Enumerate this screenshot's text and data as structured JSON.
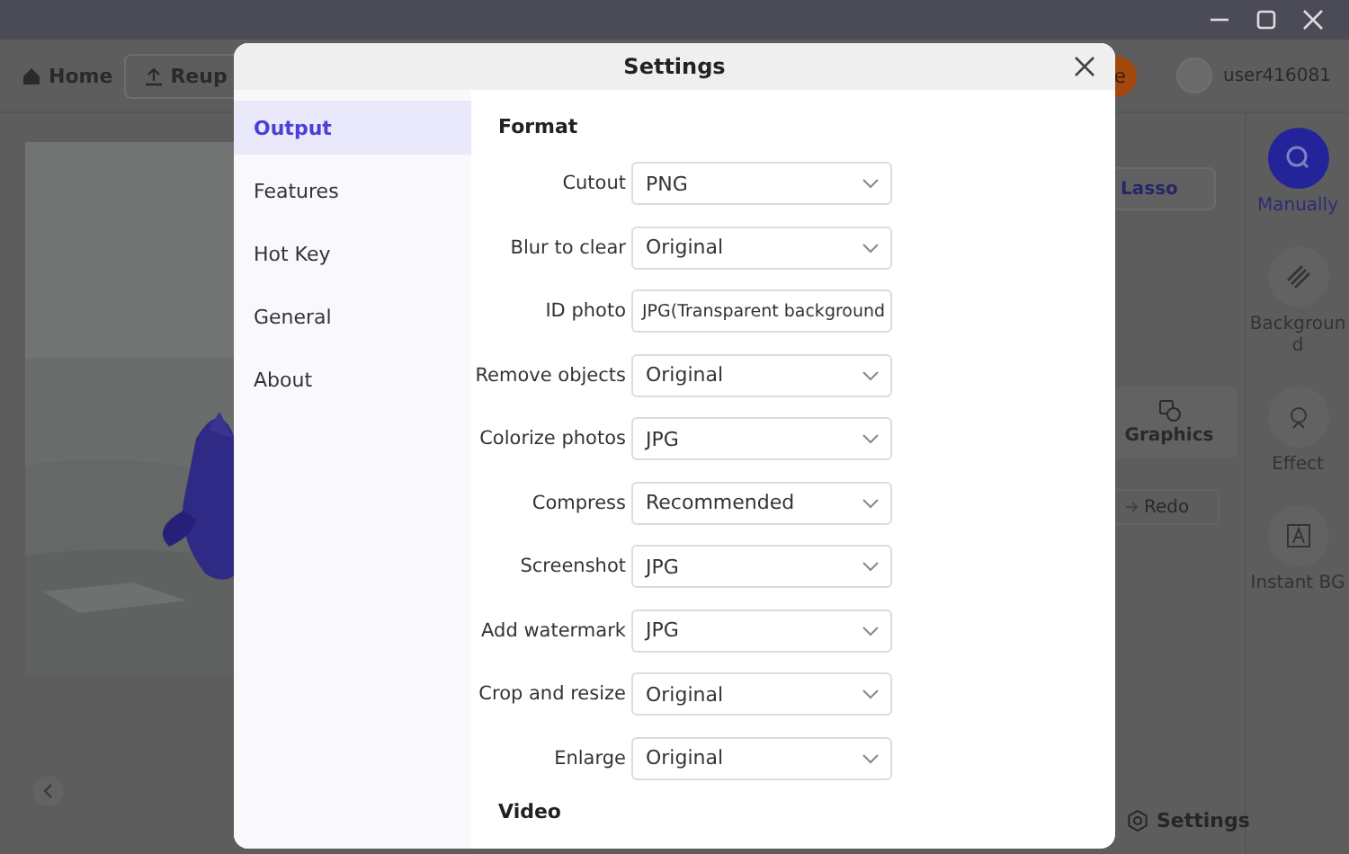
{
  "app": {
    "home": "Home",
    "reupload": "Reup",
    "action_button": "e",
    "user": "user416081",
    "tools": {
      "lasso": "Lasso",
      "graphics": "Graphics",
      "redo": "Redo",
      "settings": "Settings"
    },
    "sidebar": [
      {
        "label": "Manually",
        "selected": true
      },
      {
        "label": "Background",
        "selected": false
      },
      {
        "label": "Effect",
        "selected": false
      },
      {
        "label": "Instant BG",
        "selected": false
      }
    ]
  },
  "dialog": {
    "title": "Settings",
    "nav": [
      {
        "label": "Output",
        "selected": true
      },
      {
        "label": "Features",
        "selected": false
      },
      {
        "label": "Hot Key",
        "selected": false
      },
      {
        "label": "General",
        "selected": false
      },
      {
        "label": "About",
        "selected": false
      }
    ],
    "section": "Format",
    "rows": [
      {
        "label": "Cutout",
        "value": "PNG",
        "kind": "select"
      },
      {
        "label": "Blur to clear",
        "value": "Original",
        "kind": "select"
      },
      {
        "label": "ID photo",
        "value": "JPG(Transparent background",
        "kind": "text"
      },
      {
        "label": "Remove objects",
        "value": "Original",
        "kind": "select"
      },
      {
        "label": "Colorize photos",
        "value": "JPG",
        "kind": "select"
      },
      {
        "label": "Compress",
        "value": "Recommended",
        "kind": "select"
      },
      {
        "label": "Screenshot",
        "value": "JPG",
        "kind": "select"
      },
      {
        "label": "Add watermark",
        "value": "JPG",
        "kind": "select"
      },
      {
        "label": "Crop and resize",
        "value": "Original",
        "kind": "select"
      },
      {
        "label": "Enlarge",
        "value": "Original",
        "kind": "select"
      }
    ],
    "next_section": "Video"
  }
}
